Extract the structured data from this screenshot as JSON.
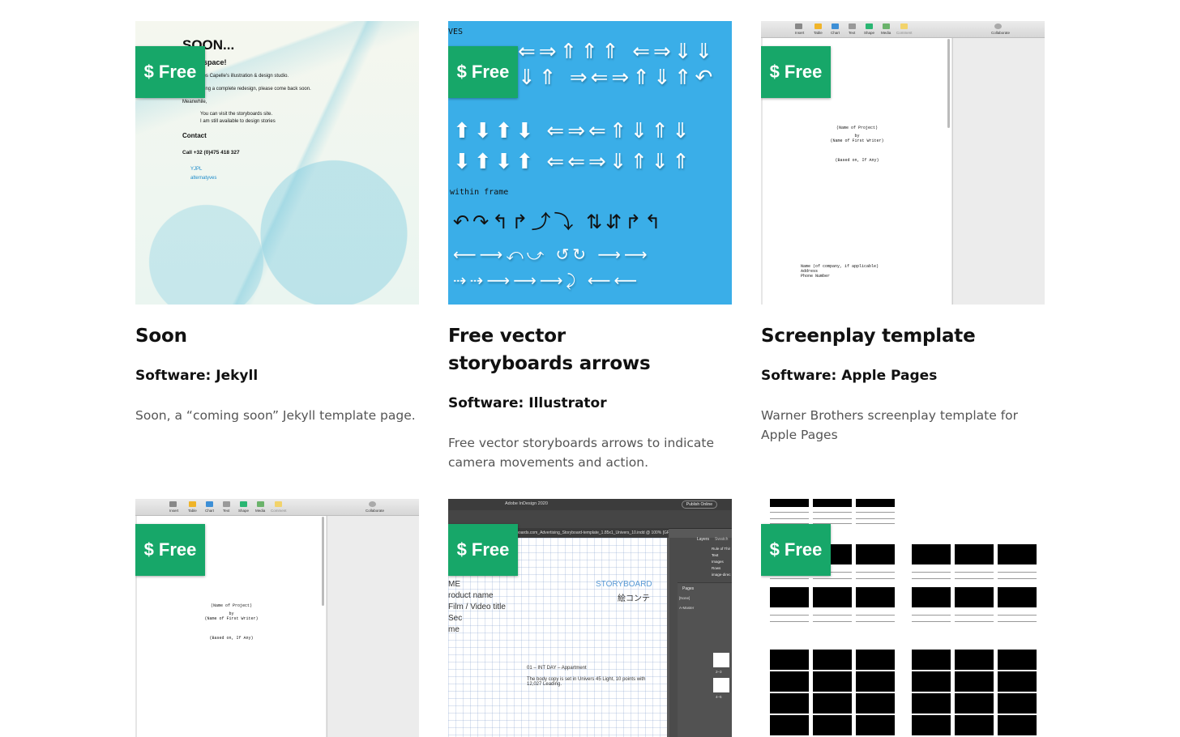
{
  "badge_label": "$ Free",
  "accent_color": "#17a769",
  "cards": [
    {
      "title": "Soon",
      "software": "Software: Jekyll",
      "description": "Soon, a “coming soon” Jekyll template page.",
      "thumb": {
        "heading": "SOON...",
        "lines": [
          "...this space!",
          "...es is Yves Capelle's illustration & design studio.",
          "...undergoing a complete redesign, please come back soon.",
          "Meanwhile,",
          "You can visit the storyboards site.",
          "I am still available to design stories",
          "Contact",
          "Call +32 (0)475 418 327",
          "YJPL",
          "alternatyves"
        ]
      }
    },
    {
      "title": "Free vector storyboards arrows",
      "software": "Software: Illustrator",
      "description": "Free vector storyboards arrows to indicate camera movements and action.",
      "thumb": {
        "label_top": "VES",
        "label_mid": "within frame"
      }
    },
    {
      "title": "Screenplay template",
      "software": "Software: Apple Pages",
      "description": "Warner Brothers screenplay template for Apple Pages",
      "thumb": {
        "toolbar": [
          "Insert",
          "Table",
          "Chart",
          "Text",
          "Shape",
          "Media",
          "Comment",
          "Collaborate"
        ],
        "lines": [
          "(Name of Project)",
          "by",
          "(Name of First Writer)",
          "(Based on, If Any)"
        ],
        "footer": [
          "Name (of company, if applicable)",
          "Address",
          "Phone Number"
        ]
      }
    },
    {
      "thumb": {
        "toolbar": [
          "Insert",
          "Table",
          "Chart",
          "Text",
          "Shape",
          "Media",
          "Comment",
          "Collaborate"
        ],
        "lines": [
          "(Name of Project)",
          "by",
          "(Name of First Writer)",
          "(Based on, If Any)"
        ]
      }
    },
    {
      "thumb": {
        "app_title": "Adobe InDesign 2020",
        "publish": "Publish Online",
        "tab": "...boards.com_Advertising_Storyboard-template_1.85x1_Univers_10.indd @ 100% [GPU Pre...",
        "panel_tabs": [
          "Layers",
          "Swatch"
        ],
        "layers": [
          "Rule of Thir",
          "Text",
          "Images",
          "Rows",
          "image-direc"
        ],
        "pages_label": "Pages",
        "pages_items": [
          "[None]",
          "A-Master"
        ],
        "page_nums": [
          "2–3",
          "4–5"
        ],
        "storyboard": "STORYBOARD",
        "storyboard_jp": "絵コンテ",
        "fields": [
          "ME",
          "roduct name",
          "Film / Video title",
          "Sec",
          "me"
        ],
        "scene": "01 – INT DAY – Appartment",
        "body": "The body copy is set in Univers 45 Light, 10 points with 12,027 Leading."
      }
    },
    {
      "thumb": {}
    }
  ]
}
